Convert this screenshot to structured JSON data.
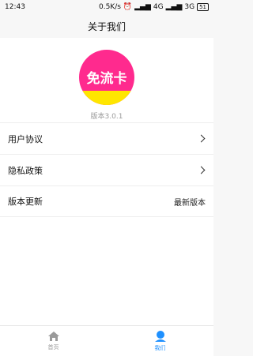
{
  "status_bar": {
    "time": "12:43",
    "net_speed": "0.5K/s",
    "signal_4g": "4G",
    "signal_3g": "3G",
    "battery": "51"
  },
  "header": {
    "title": "关于我们"
  },
  "logo": {
    "text": "免流卡"
  },
  "version": "版本3.0.1",
  "menu": [
    {
      "label": "用户协议",
      "value": ""
    },
    {
      "label": "隐私政策",
      "value": ""
    },
    {
      "label": "版本更新",
      "value": "最新版本"
    }
  ],
  "tabs": [
    {
      "label": "首页",
      "icon": "home-icon"
    },
    {
      "label": "我们",
      "icon": "user-icon"
    }
  ],
  "colors": {
    "accent": "#1e90ff",
    "logo_pink": "#ff2a8e",
    "logo_yellow": "#ffe600"
  }
}
